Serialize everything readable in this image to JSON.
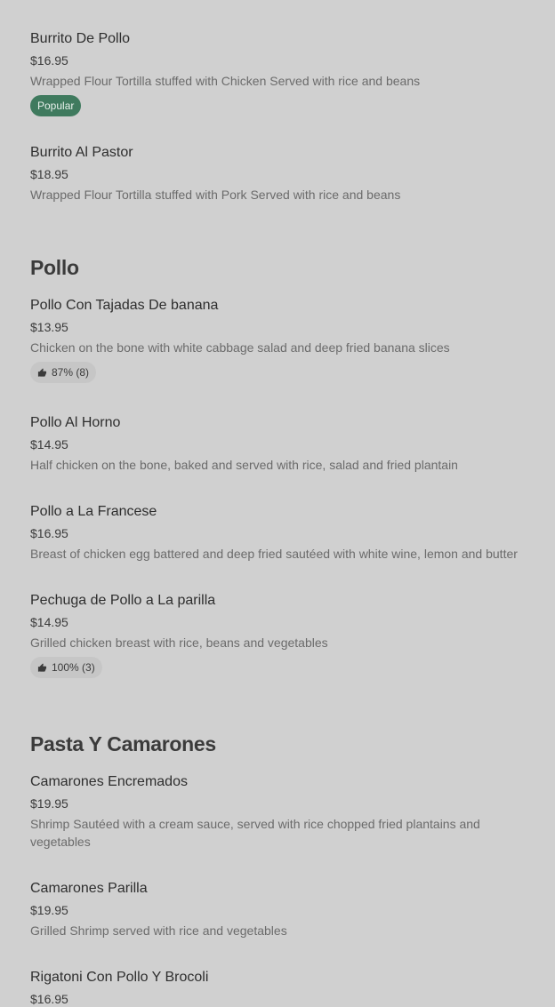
{
  "menu": {
    "top_items": [
      {
        "name": "Burrito De Pollo",
        "price": "$16.95",
        "description": "Wrapped Flour Tortilla stuffed with Chicken Served with rice and beans",
        "badge": "Popular"
      },
      {
        "name": "Burrito Al Pastor",
        "price": "$18.95",
        "description": "Wrapped Flour Tortilla stuffed with Pork Served with rice and beans"
      }
    ],
    "sections": [
      {
        "title": "Pollo",
        "items": [
          {
            "name": "Pollo Con Tajadas De banana",
            "price": "$13.95",
            "description": "Chicken on the bone with white cabbage salad and deep fried banana slices",
            "rating": "87% (8)"
          },
          {
            "name": "Pollo Al Horno",
            "price": "$14.95",
            "description": "Half chicken on the bone, baked and served with rice, salad and fried plantain"
          },
          {
            "name": "Pollo a La Francese",
            "price": "$16.95",
            "description": "Breast of chicken egg battered and deep fried sautéed with white wine, lemon and butter"
          },
          {
            "name": "Pechuga de Pollo a La parilla",
            "price": "$14.95",
            "description": "Grilled chicken breast with rice, beans and vegetables",
            "rating": "100% (3)"
          }
        ]
      },
      {
        "title": "Pasta Y Camarones",
        "items": [
          {
            "name": "Camarones Encremados",
            "price": "$19.95",
            "description": "Shrimp Sautéed with a cream sauce, served with rice chopped fried plantains and vegetables"
          },
          {
            "name": "Camarones Parilla",
            "price": "$19.95",
            "description": "Grilled Shrimp served with rice and vegetables"
          },
          {
            "name": "Rigatoni Con Pollo Y Brocoli",
            "price": "$16.95",
            "description": ""
          }
        ]
      }
    ]
  },
  "icons": {
    "rating": "thumbs-up-icon"
  },
  "colors": {
    "popular_badge": "#3f7a5e",
    "rating_badge": "#c6c6c6",
    "background": "#d0d0d0"
  }
}
